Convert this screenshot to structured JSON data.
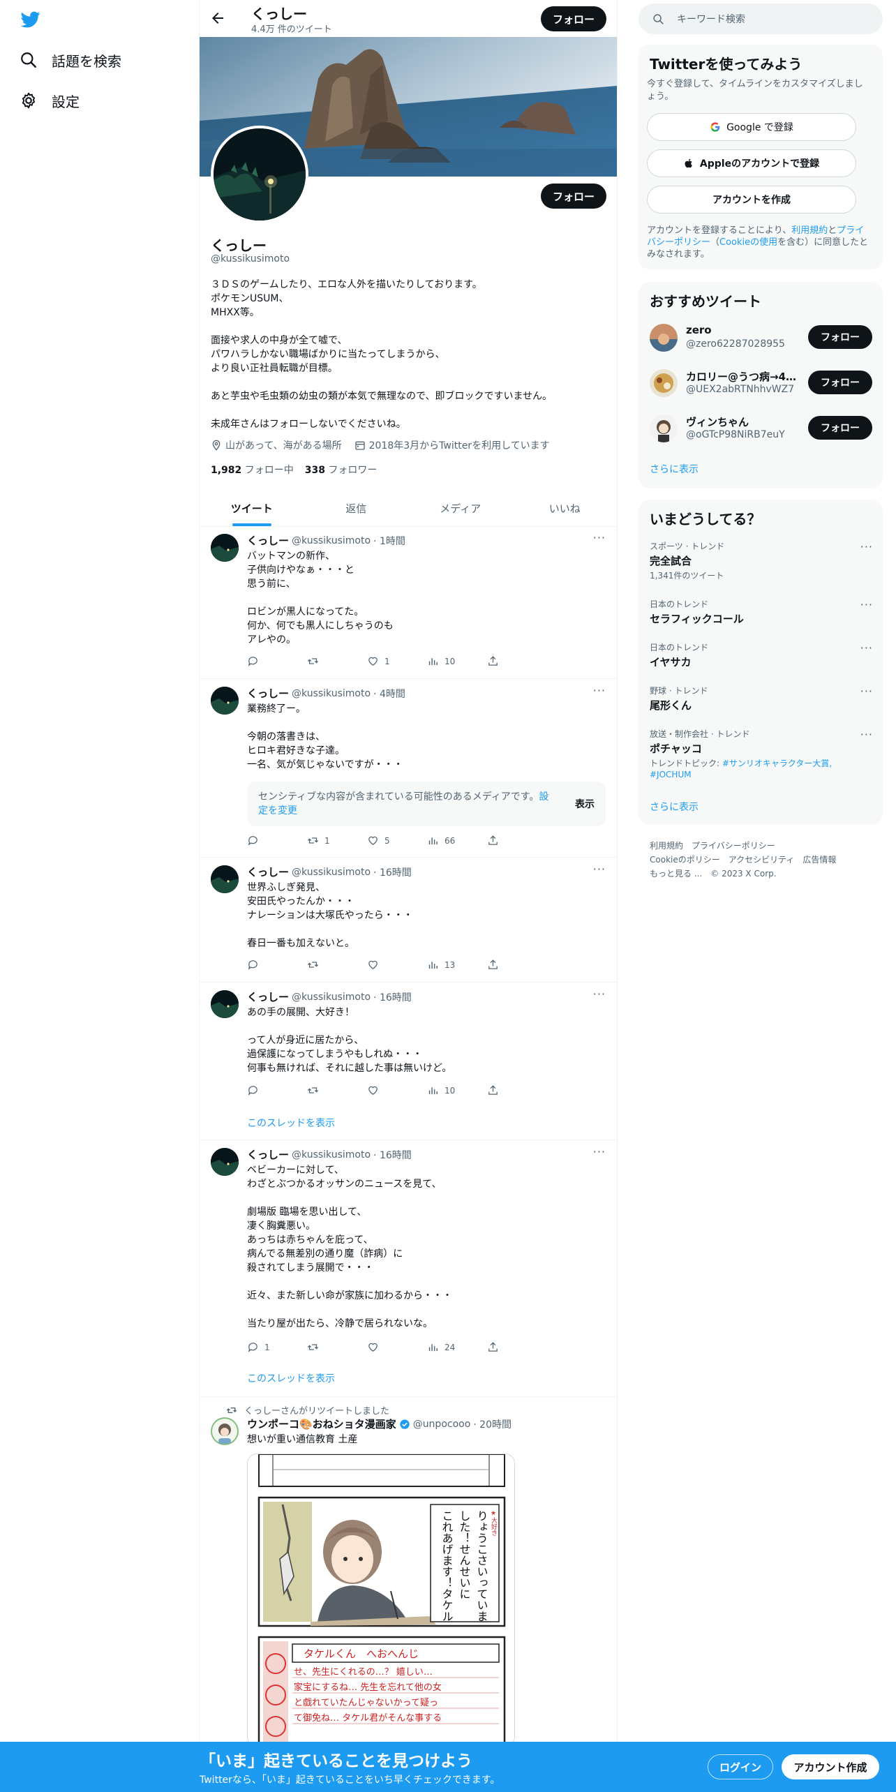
{
  "nav": {
    "explore_label": "話題を検索",
    "settings_label": "設定"
  },
  "topbar": {
    "name": "くっしー",
    "tweet_count": "4.4万 件のツイート",
    "follow_label": "フォロー"
  },
  "profile": {
    "name": "くっしー",
    "handle": "@kussikusimoto",
    "follow_label": "フォロー",
    "bio": "３ＤＳのゲームしたり、エロな人外を描いたりしております。\nポケモンUSUM、\nMHXX等。\n\n面接や求人の中身が全て嘘で、\nパワハラしかない職場ばかりに当たってしまうから、\nより良い正社員転職が目標。\n\nあと芋虫や毛虫類の幼虫の類が本気で無理なので、即ブロックですいません。\n\n未成年さんはフォローしないでくださいね。",
    "location": "山があって、海がある場所",
    "joined": "2018年3月からTwitterを利用しています",
    "following_count": "1,982",
    "following_label": "フォロー中",
    "followers_count": "338",
    "followers_label": "フォロワー"
  },
  "tabs": [
    "ツイート",
    "返信",
    "メディア",
    "いいね"
  ],
  "tweets": [
    {
      "name": "くっしー",
      "handle": "@kussikusimoto",
      "time": "· 1時間",
      "text": "バットマンの新作、\n子供向けやなぁ・・・と\n思う前に、\n\nロビンが黒人になってた。\n何か、何でも黒人にしちゃうのも\nアレやの。",
      "replies": "",
      "retweets": "",
      "likes": "1",
      "views": "10"
    },
    {
      "name": "くっしー",
      "handle": "@kussikusimoto",
      "time": "· 4時間",
      "text": "業務終了ー。\n\n今朝の落書きは、\nヒロキ君好きな子達。\n一名、気が気じゃないですが・・・",
      "sensitive_text": "センシティブな内容が含まれている可能性のあるメディアです。",
      "sensitive_link": "設定を変更",
      "sensitive_button": "表示",
      "replies": "",
      "retweets": "1",
      "likes": "5",
      "views": "66"
    },
    {
      "name": "くっしー",
      "handle": "@kussikusimoto",
      "time": "· 16時間",
      "text": "世界ふしぎ発見、\n安田氏やったんか・・・\nナレーションは大塚氏やったら・・・\n\n春日一番も加えないと。",
      "replies": "",
      "retweets": "",
      "likes": "",
      "views": "13"
    },
    {
      "name": "くっしー",
      "handle": "@kussikusimoto",
      "time": "· 16時間",
      "text": "あの手の展開、大好き！\n\nって人が身近に居たから、\n過保護になってしまうやもしれぬ・・・\n何事も無ければ、それに越した事は無いけど。",
      "replies": "",
      "retweets": "",
      "likes": "",
      "views": "10",
      "thread_link": "このスレッドを表示"
    },
    {
      "name": "くっしー",
      "handle": "@kussikusimoto",
      "time": "· 16時間",
      "text": "ベビーカーに対して、\nわざとぶつかるオッサンのニュースを見て、\n\n劇場版 臨場を思い出して、\n凄く胸糞悪い。\nあっちは赤ちゃんを庇って、\n病んでる無差別の通り魔（詐病）に\n殺されてしまう展開で・・・\n\n近々、また新しい命が家族に加わるから・・・\n\n当たり屋が出たら、冷静で居られないな。",
      "replies": "1",
      "retweets": "",
      "likes": "",
      "views": "24",
      "thread_link": "このスレッドを表示"
    },
    {
      "retweet_label": "くっしーさんがリツイートしました",
      "name": "ウンポーコ🎨おねショタ漫画家",
      "handle": "@unpocooo",
      "time": "· 20時間",
      "text": "想いが重い通信教育 土産",
      "manga_line1": "りょうこさいっていま",
      "manga_line2": "した！せんせいに",
      "manga_line3": "これあげます！タケル",
      "manga_corner": "★大好き",
      "manga_letter_title": "タケルくん　へおへんじ",
      "manga_letter_1": "せ、先生にくれるの…？ 嬉しい…",
      "manga_letter_2": "家宝にするね… 先生を忘れて他の女",
      "manga_letter_3": "と戯れていたんじゃないかって疑っ",
      "manga_letter_4": "て御免ね… タケル君がそんな事する"
    }
  ],
  "sidebar": {
    "search_placeholder": "キーワード検索",
    "signup": {
      "title": "Twitterを使ってみよう",
      "subtitle": "今すぐ登録して、タイムラインをカスタマイズしましょう。",
      "google_label": "Google で登録",
      "apple_label": "Appleのアカウントで登録",
      "create_label": "アカウントを作成",
      "legal_prefix": "アカウントを登録することにより、",
      "legal_terms": "利用規約",
      "legal_and": "と",
      "legal_privacy": "プライバシーポリシー",
      "legal_cookie_open": "（",
      "legal_cookie": "Cookieの使用",
      "legal_suffix": "を含む）に同意したとみなされます。"
    },
    "recommend": {
      "title": "おすすめツイート",
      "users": [
        {
          "name": "zero",
          "handle": "@zero62287028955",
          "button": "フォロー"
        },
        {
          "name": "カロリー@うつ病→4...",
          "handle": "@UEX2abRTNhhvWZ7",
          "button": "フォロー"
        },
        {
          "name": "ヴィンちゃん",
          "handle": "@oGTcP98NiRB7euY",
          "button": "フォロー"
        }
      ],
      "more": "さらに表示"
    },
    "trends": {
      "title": "いまどうしてる？",
      "items": [
        {
          "context": "スポーツ · トレンド",
          "name": "完全試合",
          "extra": "1,341件のツイート"
        },
        {
          "context": "日本のトレンド",
          "name": "セラフィックコール",
          "extra": ""
        },
        {
          "context": "日本のトレンド",
          "name": "イヤサカ",
          "extra": ""
        },
        {
          "context": "野球 · トレンド",
          "name": "尾形くん",
          "extra": ""
        },
        {
          "context": "放送・制作会社 · トレンド",
          "name": "ポチャッコ",
          "extra_prefix": "トレンドトピック: ",
          "extra_tags": "#サンリオキャラクター大賞, #JOCHUM"
        }
      ],
      "more": "さらに表示"
    },
    "footer": {
      "terms": "利用規約",
      "privacy": "プライバシーポリシー",
      "cookie": "Cookieのポリシー",
      "accessibility": "アクセシビリティ",
      "ads": "広告情報",
      "more": "もっと見る ...",
      "copyright": "© 2023 X Corp."
    }
  },
  "bottombar": {
    "title": "「いま」起きていることを見つけよう",
    "subtitle": "Twitterなら、「いま」起きていることをいち早くチェックできます。",
    "login": "ログイン",
    "signup": "アカウント作成"
  },
  "colors": {
    "accent": "#1d9bf0",
    "text": "#0f1419",
    "secondary": "#536471"
  }
}
